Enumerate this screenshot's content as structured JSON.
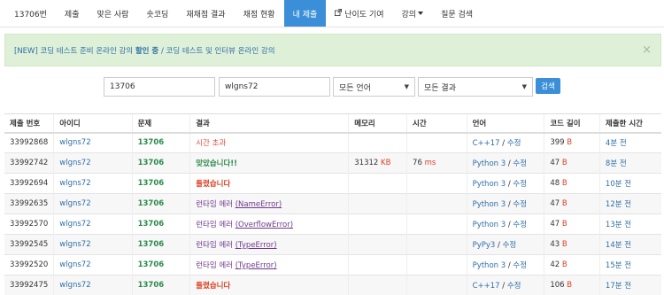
{
  "nav": {
    "items": [
      {
        "label": "13706번"
      },
      {
        "label": "제출"
      },
      {
        "label": "맞은 사람"
      },
      {
        "label": "숏코딩"
      },
      {
        "label": "재채점 결과"
      },
      {
        "label": "채점 현황"
      },
      {
        "label": "내 제출",
        "active": true
      },
      {
        "label": "난이도 기여",
        "icon": "external-link-icon"
      },
      {
        "label": "강의",
        "dropdown": true
      },
      {
        "label": "질문 검색"
      }
    ]
  },
  "notice": {
    "part1": "[NEW] 코딩 테스트 준비 온라인 강의 ",
    "bold": "할인 중",
    "part2": " / 코딩 테스트 및 인터뷰 온라인 강의",
    "close": "×"
  },
  "filters": {
    "problem_id": "13706",
    "user_id": "wlgns72",
    "language": "모든 언어",
    "result": "모든 결과",
    "search_label": "검색"
  },
  "table": {
    "headers": [
      "제출 번호",
      "아이디",
      "문제",
      "결과",
      "메모리",
      "시간",
      "언어",
      "코드 길이",
      "제출한 시간"
    ],
    "rows": [
      {
        "id": "33992868",
        "user": "wlgns72",
        "problem": "13706",
        "result": "시간 초과",
        "result_kind": "tle",
        "memory": "",
        "memory_unit": "",
        "time": "",
        "time_unit": "",
        "lang": "C++17",
        "edit": "수정",
        "code_len": "399",
        "code_unit": "B",
        "submitted": "4분 전"
      },
      {
        "id": "33992742",
        "user": "wlgns72",
        "problem": "13706",
        "result": "맞았습니다!!",
        "result_kind": "ac",
        "memory": "31312",
        "memory_unit": "KB",
        "time": "76",
        "time_unit": "ms",
        "lang": "Python 3",
        "edit": "수정",
        "code_len": "47",
        "code_unit": "B",
        "submitted": "8분 전"
      },
      {
        "id": "33992694",
        "user": "wlgns72",
        "problem": "13706",
        "result": "틀렸습니다",
        "result_kind": "wa",
        "memory": "",
        "memory_unit": "",
        "time": "",
        "time_unit": "",
        "lang": "Python 3",
        "edit": "수정",
        "code_len": "48",
        "code_unit": "B",
        "submitted": "10분 전"
      },
      {
        "id": "33992635",
        "user": "wlgns72",
        "problem": "13706",
        "result": "런타임 에러 ",
        "result_detail": "(NameError)",
        "result_kind": "rte",
        "memory": "",
        "memory_unit": "",
        "time": "",
        "time_unit": "",
        "lang": "Python 3",
        "edit": "수정",
        "code_len": "47",
        "code_unit": "B",
        "submitted": "12분 전"
      },
      {
        "id": "33992570",
        "user": "wlgns72",
        "problem": "13706",
        "result": "런타임 에러 ",
        "result_detail": "(OverflowError)",
        "result_kind": "rte",
        "memory": "",
        "memory_unit": "",
        "time": "",
        "time_unit": "",
        "lang": "Python 3",
        "edit": "수정",
        "code_len": "47",
        "code_unit": "B",
        "submitted": "13분 전"
      },
      {
        "id": "33992545",
        "user": "wlgns72",
        "problem": "13706",
        "result": "런타임 에러 ",
        "result_detail": "(TypeError)",
        "result_kind": "rte",
        "memory": "",
        "memory_unit": "",
        "time": "",
        "time_unit": "",
        "lang": "PyPy3",
        "edit": "수정",
        "code_len": "43",
        "code_unit": "B",
        "submitted": "14분 전"
      },
      {
        "id": "33992520",
        "user": "wlgns72",
        "problem": "13706",
        "result": "런타임 에러 ",
        "result_detail": "(TypeError)",
        "result_kind": "rte",
        "memory": "",
        "memory_unit": "",
        "time": "",
        "time_unit": "",
        "lang": "Python 3",
        "edit": "수정",
        "code_len": "42",
        "code_unit": "B",
        "submitted": "15분 전"
      },
      {
        "id": "33992475",
        "user": "wlgns72",
        "problem": "13706",
        "result": "틀렸습니다",
        "result_kind": "wa",
        "memory": "",
        "memory_unit": "",
        "time": "",
        "time_unit": "",
        "lang": "C++17",
        "edit": "수정",
        "code_len": "106",
        "code_unit": "B",
        "submitted": "17분 전"
      }
    ]
  },
  "colors": {
    "nav_active": "#3a8fd8",
    "notice_bg": "#dff0d8",
    "link": "#2f6fa8",
    "accepted": "#2c8a4c",
    "wrong": "#dd4124",
    "runtime_error": "#6f3a8e"
  }
}
